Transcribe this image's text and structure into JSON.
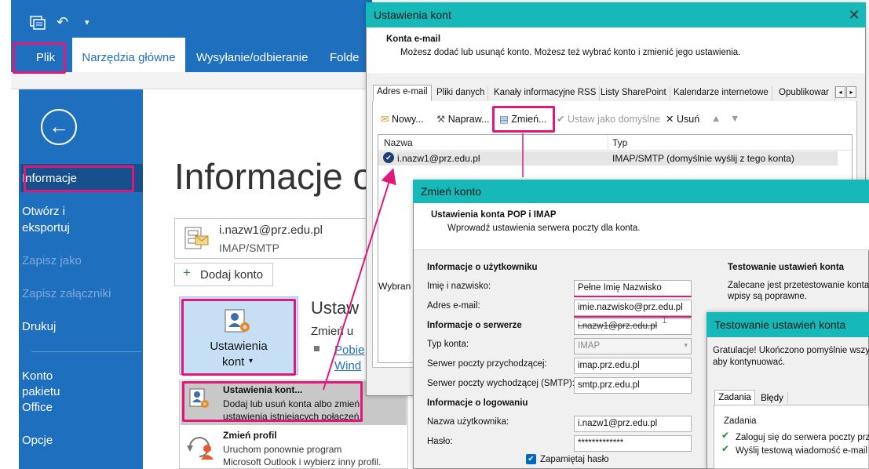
{
  "colors": {
    "outlook_blue": "#1f6fbf",
    "highlight": "#e0187a",
    "dialog_teal": "#17b8b8"
  },
  "outlook": {
    "tabs": {
      "file": "Plik",
      "home": "Narzędzia główne",
      "send_receive": "Wysyłanie/odbieranie",
      "folder": "Folde"
    },
    "backstage": {
      "info": "Informacje",
      "open_export_1": "Otwórz i",
      "open_export_2": "eksportuj",
      "save_as": "Zapisz jako",
      "save_attachments": "Zapisz załączniki",
      "print": "Drukuj",
      "office_account_1": "Konto",
      "office_account_2": "pakietu",
      "office_account_3": "Office",
      "options": "Opcje"
    },
    "page_title": "Informacje o",
    "account": {
      "email": "i.nazw1@prz.edu.pl",
      "type": "IMAP/SMTP"
    },
    "add_account": "Dodaj konto",
    "settings_button_1": "Ustawienia",
    "settings_button_2": "kont",
    "settings_section_title": "Ustaw",
    "settings_section_sub": "Zmień u",
    "settings_link_1": "Pobie",
    "settings_link_2": "Wind",
    "dropdown": {
      "item1_title": "Ustawienia kont...",
      "item1_desc_1": "Dodaj lub usuń konta albo zmień",
      "item1_desc_2": "ustawienia istniejących połączeń.",
      "item2_title": "Zmień profil",
      "item2_desc_1": "Uruchom ponownie program",
      "item2_desc_2": "Microsoft Outlook i wybierz inny profil."
    }
  },
  "accounts_dialog": {
    "title": "Ustawienia kont",
    "close": "✕",
    "heading": "Konta e-mail",
    "subheading": "Możesz dodać lub usunąć konto. Możesz też wybrać konto i zmienić jego ustawienia.",
    "tabs": [
      "Adres e-mail",
      "Pliki danych",
      "Kanały informacyjne RSS",
      "Listy SharePoint",
      "Kalendarze internetowe",
      "Opublikowar"
    ],
    "toolbar": {
      "new": "Nowy...",
      "repair": "Napraw...",
      "change": "Zmień...",
      "set_default": "Ustaw jako domyślne",
      "remove": "Usuń"
    },
    "columns": {
      "name": "Nazwa",
      "type": "Typ"
    },
    "row": {
      "name": "i.nazw1@prz.edu.pl",
      "type": "IMAP/SMTP (domyślnie wyślij z tego konta)"
    },
    "selected_prefix": "Wybran"
  },
  "change_dialog": {
    "title": "Zmień konto",
    "heading": "Ustawienia konta POP i IMAP",
    "subheading": "Wprowadź ustawienia serwera poczty dla konta.",
    "user_info": "Informacje o użytkowniku",
    "name_label": "Imię i nazwisko:",
    "name_value": "Pełne Imię Nazwisko",
    "email_label": "Adres e-mail:",
    "email_value": "imie.nazwisko@prz.edu.pl",
    "email_old": "i.nazw1@prz.edu.pl",
    "server_info": "Informacje o serwerze",
    "account_type_label": "Typ konta:",
    "account_type_value": "IMAP",
    "incoming_label": "Serwer poczty przychodzącej:",
    "incoming_value": "imap.prz.edu.pl",
    "outgoing_label": "Serwer poczty wychodzącej (SMTP):",
    "outgoing_value": "smtp.prz.edu.pl",
    "logon_info": "Informacje o logowaniu",
    "username_label": "Nazwa użytkownika:",
    "username_value": "i.nazw1@prz.edu.pl",
    "password_label": "Hasło:",
    "password_value": "*************",
    "remember_password": "Zapamiętaj hasło",
    "test_heading": "Testowanie ustawień konta",
    "test_desc_1": "Zalecane jest przetestowanie konta",
    "test_desc_2": "wpisy są poprawne."
  },
  "test_dialog": {
    "title": "Testowanie ustawień konta",
    "msg_1": "Gratulacje! Ukończono pomyślnie wszy",
    "msg_2": "aby kontynuować.",
    "tab_tasks": "Zadania",
    "tab_errors": "Błędy",
    "col_tasks": "Zadania",
    "task1": "Zaloguj się do serwera poczty przy",
    "task2": "Wyślij testową wiadomość e-mail"
  }
}
